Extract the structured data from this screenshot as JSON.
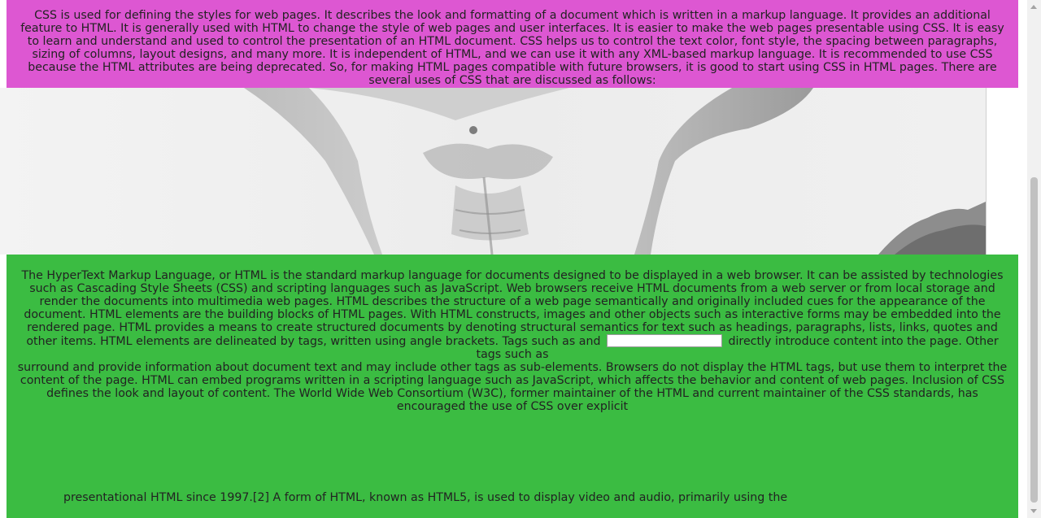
{
  "css_section": {
    "paragraph": "CSS is used for defining the styles for web pages. It describes the look and formatting of a document which is written in a markup language. It provides an additional feature to HTML. It is generally used with HTML to change the style of web pages and user interfaces. It is easier to make the web pages presentable using CSS. It is easy to learn and understand and used to control the presentation of an HTML document. CSS helps us to control the text color, font style, the spacing between paragraphs, sizing of columns, layout designs, and many more. It is independent of HTML, and we can use it with any XML-based markup language. It is recommended to use CSS because the HTML attributes are being deprecated. So, for making HTML pages compatible with future browsers, it is good to start using CSS in HTML pages. There are several uses of CSS that are discussed as follows:",
    "background_color": "#dd57d2"
  },
  "photo": {
    "icon": "bodybuilder-photo"
  },
  "html_section": {
    "background_color": "#3bbc42",
    "part1_before_input": "The HyperText Markup Language, or HTML is the standard markup language for documents designed to be displayed in a web browser. It can be assisted by technologies such as Cascading Style Sheets (CSS) and scripting languages such as JavaScript. Web browsers receive HTML documents from a web server or from local storage and render the documents into multimedia web pages. HTML describes the structure of a web page semantically and originally included cues for the appearance of the document. HTML elements are the building blocks of HTML pages. With HTML constructs, images and other objects such as interactive forms may be embedded into the rendered page. HTML provides a means to create structured documents by denoting structural semantics for text such as headings, paragraphs, lists, links, quotes and other items. HTML elements are delineated by tags, written using angle brackets. Tags such as  and",
    "input_value": "",
    "part1_after_input": "directly introduce content into the page. Other tags such as",
    "part2": "surround and provide information about document text and may include other tags as sub-elements. Browsers do not display the HTML tags, but use them to interpret the content of the page. HTML can embed programs written in a scripting language such as JavaScript, which affects the behavior and content of web pages. Inclusion of CSS defines the look and layout of content. The World Wide Web Consortium (W3C), former maintainer of the HTML and current maintainer of the CSS standards, has encouraged the use of CSS over explicit",
    "part3": "presentational HTML since 1997.[2] A form of HTML, known as HTML5, is used to display video and audio, primarily using the"
  }
}
